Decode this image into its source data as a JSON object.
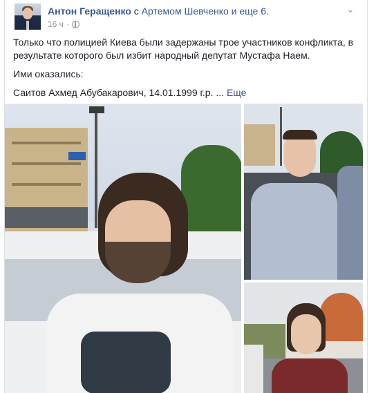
{
  "post": {
    "author": "Антон Геращенко",
    "with_text": " с ",
    "tagged": "Артемом Шевченко и еще 6.",
    "time": "16 ч",
    "dot": "·",
    "body_line1": "Только что полицией Киева были задержаны трое участников конфликта, в результате которого был избит народный депутат Мустафа Наем.",
    "body_line2": "Ими оказались:",
    "body_line3": "Саитов Ахмед Абубакарович, 14.01.1999 г.р.",
    "ellipsis": " ... ",
    "see_more": "Еще"
  },
  "icons": {
    "globe": "globe-icon",
    "options": "chevron-down-icon"
  }
}
